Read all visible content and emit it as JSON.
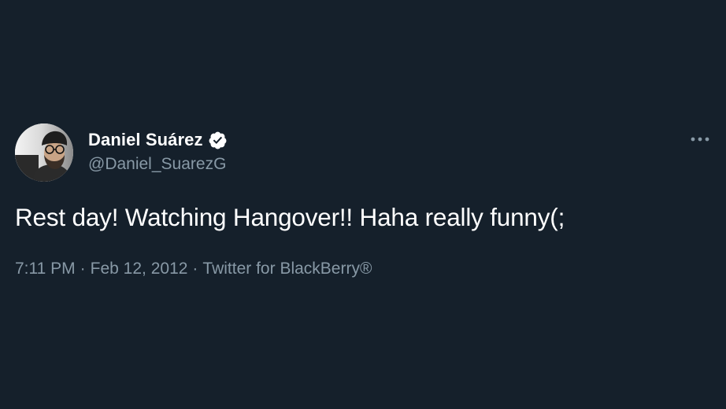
{
  "tweet": {
    "author": {
      "display_name": "Daniel Suárez",
      "handle": "@Daniel_SuarezG",
      "verified": true,
      "avatar_icon": "profile-photo"
    },
    "text": "Rest day! Watching Hangover!! Haha really funny(;",
    "meta": {
      "time": "7:11 PM",
      "separator": "·",
      "date": "Feb 12, 2012",
      "source": "Twitter for BlackBerry®"
    },
    "more_icon": "more-horizontal-icon"
  },
  "colors": {
    "background": "#15202b",
    "primary_text": "#ffffff",
    "secondary_text": "#8899a6"
  }
}
